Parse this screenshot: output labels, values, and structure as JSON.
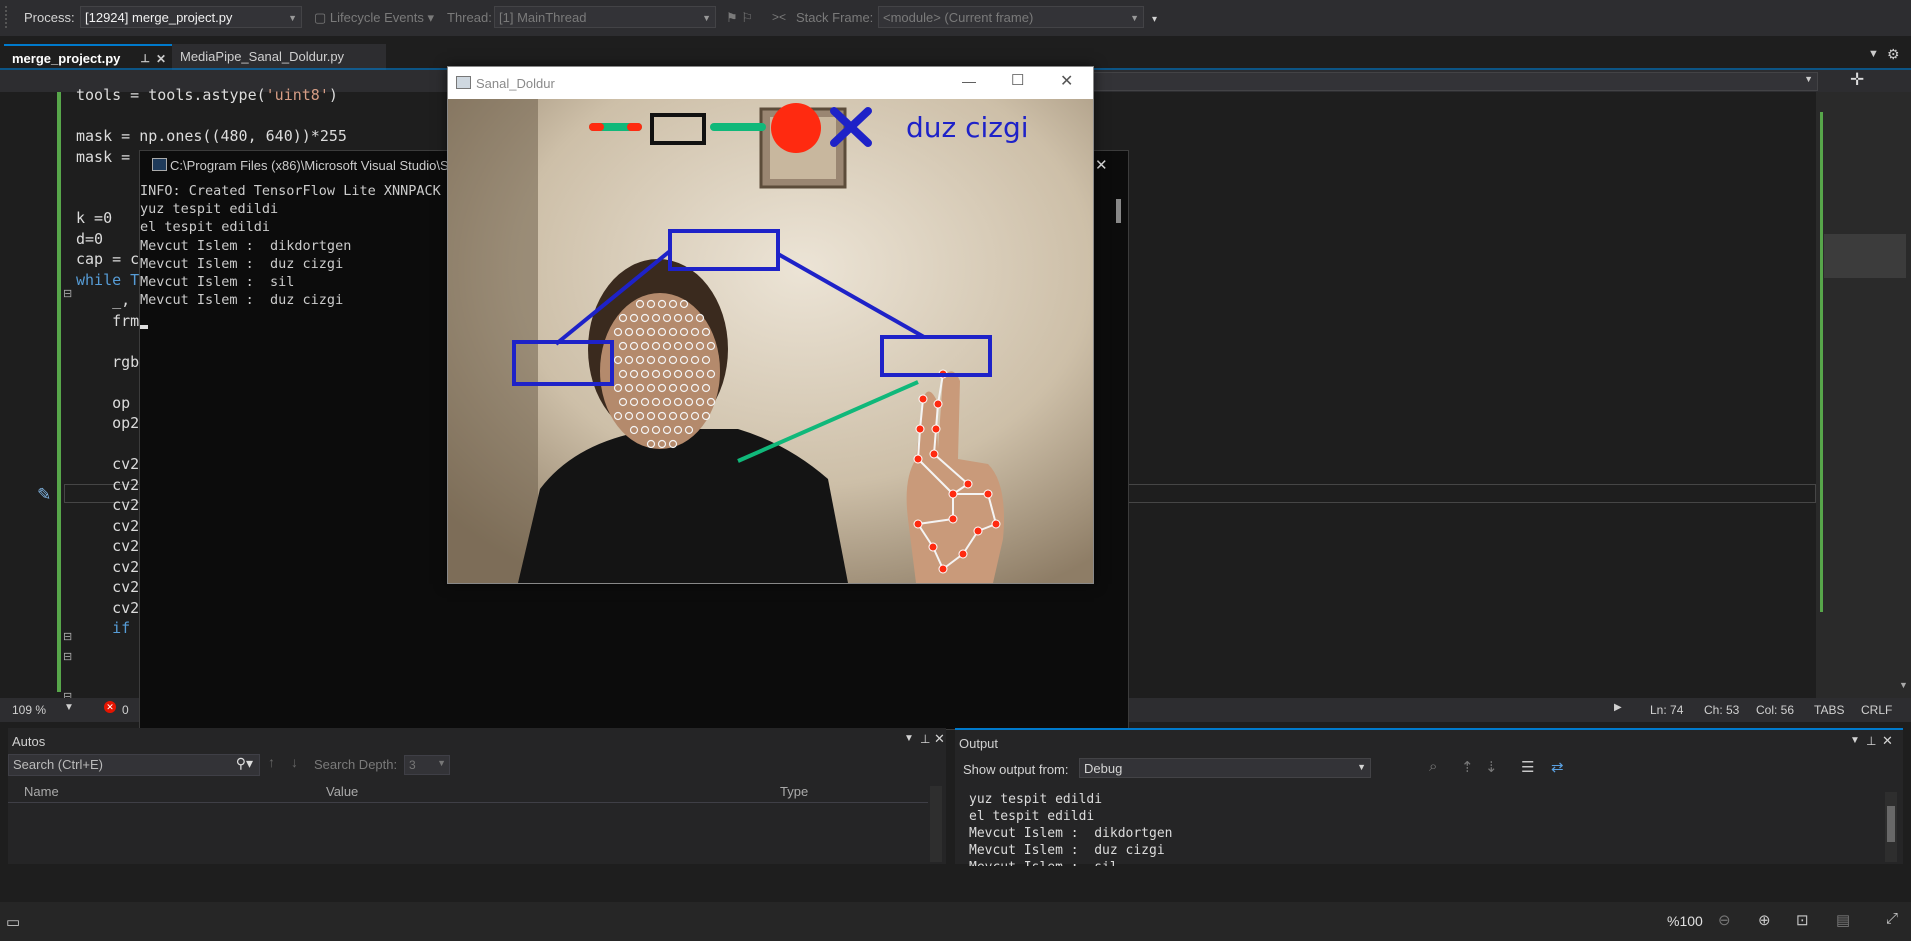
{
  "toolbar": {
    "process_label": "Process:",
    "process_value": "[12924] merge_project.py",
    "lifecycle_label": "Lifecycle Events",
    "thread_label": "Thread:",
    "thread_value": "[1] MainThread",
    "stack_frame_label": "Stack Frame:",
    "stack_frame_value": "<module> (Current frame)"
  },
  "tabs": [
    {
      "label": "merge_project.py",
      "active": true
    },
    {
      "label": "MediaPipe_Sanal_Doldur.py",
      "active": false
    }
  ],
  "editor": {
    "lines": [
      "tools = tools.astype('uint8')",
      "",
      "mask = np.ones((480, 640))*255",
      "mask = m",
      "",
      "",
      "k =0",
      "d=0",
      "cap = c",
      "while T",
      "    _,",
      "    frm",
      "",
      "    rgb",
      "",
      "    op",
      "    op2",
      "",
      "    cv2",
      "    cv2",
      "    cv2",
      "    cv2",
      "    cv2",
      "    cv2",
      "    cv2",
      "    cv2",
      "    if"
    ],
    "status": {
      "zoom": "109 %",
      "errors": "0",
      "line": "Ln: 74",
      "char": "Ch: 53",
      "col": "Col: 56",
      "tabs": "TABS",
      "eol": "CRLF"
    }
  },
  "console": {
    "title": "C:\\Program Files (x86)\\Microsoft Visual Studio\\S",
    "lines": [
      "INFO: Created TensorFlow Lite XNNPACK",
      "yuz tespit edildi",
      "el tespit edildi",
      "Mevcut Islem :  dikdortgen",
      "Mevcut Islem :  duz cizgi",
      "Mevcut Islem :  sil",
      "Mevcut Islem :  duz cizgi"
    ]
  },
  "camera": {
    "title": "Sanal_Doldur",
    "overlay_text": "duz cizgi",
    "colors": {
      "red": "#ff2a10",
      "green": "#10b87a",
      "blue": "#1e22c8",
      "box": "#111111"
    }
  },
  "autos": {
    "title": "Autos",
    "search_placeholder": "Search (Ctrl+E)",
    "search_depth_label": "Search Depth:",
    "search_depth_value": "3",
    "columns": [
      "Name",
      "Value",
      "Type"
    ]
  },
  "output": {
    "title": "Output",
    "show_from_label": "Show output from:",
    "show_from_value": "Debug",
    "lines": [
      "yuz tespit edildi",
      "el tespit edildi",
      "Mevcut Islem :  dikdortgen",
      "Mevcut Islem :  duz cizgi",
      "Mevcut Islem :  sil"
    ]
  },
  "player": {
    "zoom": "%100"
  }
}
